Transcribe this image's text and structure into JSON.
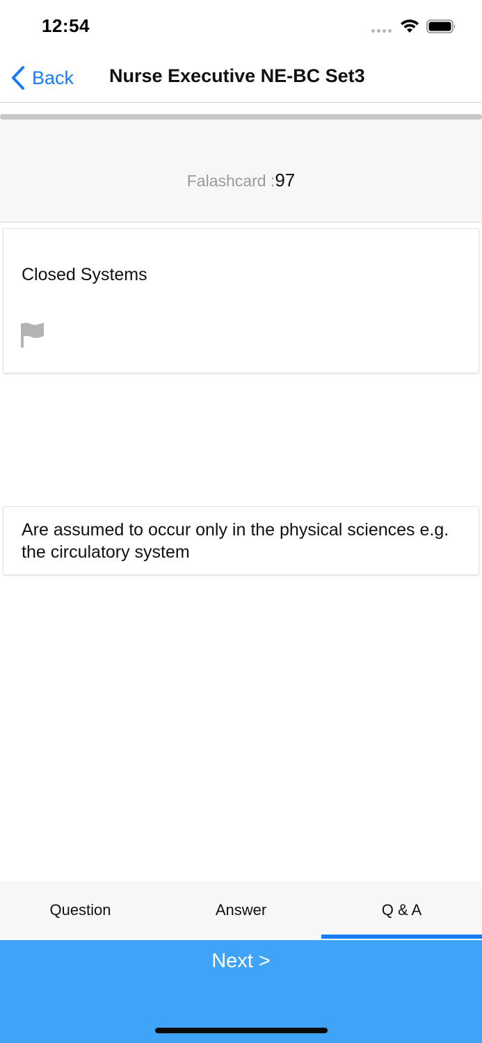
{
  "status_bar": {
    "time": "12:54"
  },
  "nav": {
    "back_label": "Back",
    "title": "Nurse Executive NE-BC Set3"
  },
  "counter": {
    "prefix": "Falashcard :",
    "value": "97"
  },
  "card": {
    "question": "Closed Systems",
    "answer": "Are assumed to occur only in the physical sciences e.g. the circulatory system"
  },
  "tabs": [
    {
      "label": "Question",
      "active": false
    },
    {
      "label": "Answer",
      "active": false
    },
    {
      "label": "Q & A",
      "active": true
    }
  ],
  "footer": {
    "next_label": "Next >"
  },
  "colors": {
    "accent": "#1a7cf5",
    "next_bar": "#3fa4f8",
    "counter_bg": "#f7f7f7"
  },
  "icons": {
    "back": "chevron-left-icon",
    "flag": "flag-icon",
    "wifi": "wifi-icon",
    "battery": "battery-icon"
  }
}
